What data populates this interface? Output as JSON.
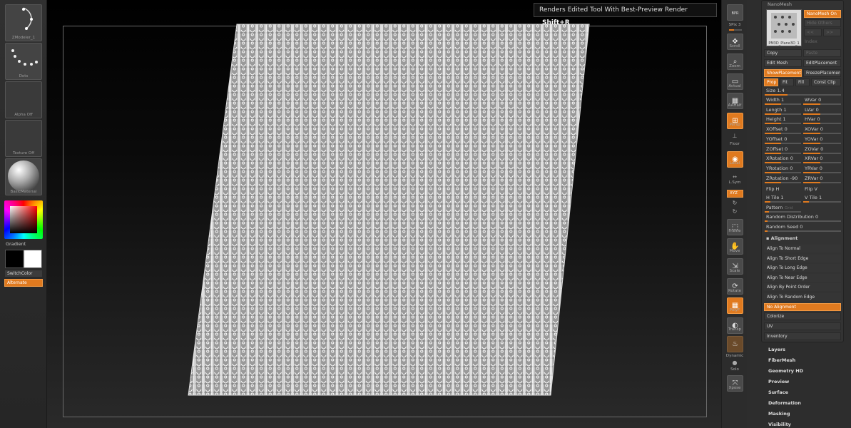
{
  "left_tray": {
    "brush_label": "ZModeler_1",
    "stroke_label": "Dots",
    "alpha_label": "Alpha Off",
    "texture_label": "Texture Off",
    "material_label": "BasicMaterial",
    "gradient_label": "Gradient",
    "switch_color_label": "SwitchColor",
    "alternate_label": "Alternate"
  },
  "tooltip": {
    "text": "Renders Edited Tool With Best-Preview Render",
    "shortcut": "Shift+R"
  },
  "right_shelf": {
    "bpr": "BPR",
    "spix": "SPix 3",
    "scroll": "Scroll",
    "zoom": "Zoom",
    "actual": "Actual",
    "aahalf": "AAHalf",
    "persp": "Persp",
    "floor": "Floor",
    "local": "Local",
    "lsym": "L.Sym",
    "xyz": "XYZ",
    "frame": "Frame",
    "move": "Move",
    "scale": "Scale",
    "rotate": "Rotate",
    "polyf": "PolyF",
    "transp": "Transp",
    "dynamic": "Dynamic",
    "solo": "Solo",
    "xpose": "Xpose"
  },
  "nanomesh": {
    "title": "NanoMesh",
    "thumb_label": "PM3D_Plane3D_1",
    "nanomesh_on": "NanoMesh On",
    "hide_others": "Hide Others",
    "index": "Index",
    "copy": "Copy",
    "paste": "Paste",
    "edit_mesh": "Edit Mesh",
    "edit_placement": "EditPlacement",
    "show_placement": "ShowPlacement",
    "freeze_placement": "FreezePlacement",
    "prop": "Prop",
    "fit": "Fit",
    "fill": "Fill",
    "const_clip": "Const Clip",
    "size": "Size 1.4",
    "sliders_left": [
      "Width 1",
      "Length 1",
      "Height 1",
      "XOffset 0",
      "YOffset 0",
      "ZOffset 0",
      "XRotation 0",
      "YRotation 0",
      "ZRotation -90"
    ],
    "sliders_right": [
      "WVar 0",
      "LVar 0",
      "HVar 0",
      "XOVar 0",
      "YOVar 0",
      "ZOVar 0",
      "XRVar 0",
      "YRVar 0",
      "ZRVar 0"
    ],
    "flip_h": "Flip H",
    "flip_v": "Flip V",
    "h_tile": "H Tile 1",
    "v_tile": "V Tile 1",
    "pattern": "Pattern",
    "grid": "Grid",
    "random_distribution": "Random Distribution 0",
    "random_seed": "Random Seed 0",
    "alignment_header": "Alignment",
    "alignment": [
      "Align To Normal",
      "Align To Short Edge",
      "Align To Long Edge",
      "Align To Near Edge",
      "Align By Point Order",
      "Align To Random Edge",
      "No Alignment"
    ],
    "colorize": "Colorize",
    "uv": "UV",
    "inventory": "Inventory"
  },
  "tool_menus": [
    "Layers",
    "FiberMesh",
    "Geometry HD",
    "Preview",
    "Surface",
    "Deformation",
    "Masking",
    "Visibility"
  ]
}
